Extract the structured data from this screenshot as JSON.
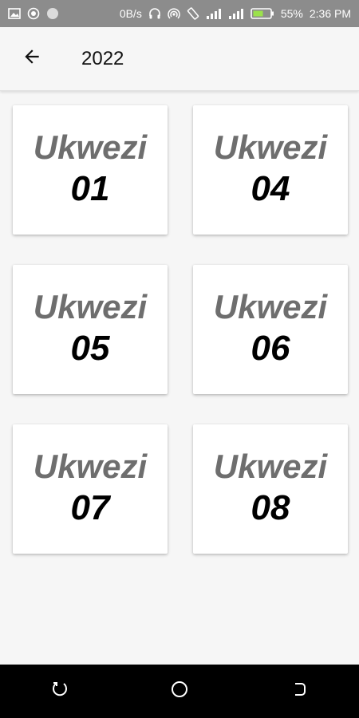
{
  "status_bar": {
    "network_speed": "0B/s",
    "battery": "55%",
    "time": "2:36 PM",
    "icons": [
      "gallery-icon",
      "record-icon",
      "circle-icon",
      "headphones-icon",
      "hotspot-icon",
      "rotate-icon",
      "signal-icon",
      "signal-icon",
      "battery-icon"
    ]
  },
  "app_bar": {
    "title": "2022",
    "back_icon": "arrow-back-icon"
  },
  "cards": [
    {
      "title": "Ukwezi",
      "number": "01"
    },
    {
      "title": "Ukwezi",
      "number": "04"
    },
    {
      "title": "Ukwezi",
      "number": "05"
    },
    {
      "title": "Ukwezi",
      "number": "06"
    },
    {
      "title": "Ukwezi",
      "number": "07"
    },
    {
      "title": "Ukwezi",
      "number": "08"
    }
  ],
  "nav_bar": {
    "icons": [
      "recents-icon",
      "home-icon",
      "back-nav-icon"
    ]
  },
  "colors": {
    "status_bar": "#8c8c8c",
    "background": "#f6f6f6",
    "card": "#ffffff",
    "card_title": "#6e6e6e",
    "card_number": "#000000",
    "nav_bar": "#000000"
  }
}
